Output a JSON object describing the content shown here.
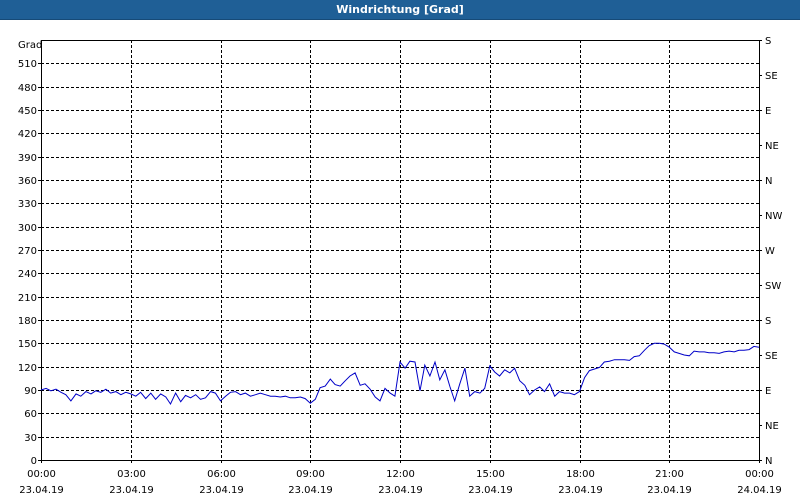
{
  "window": {
    "title": "Windrichtung [Grad]"
  },
  "chart_data": {
    "type": "line",
    "title": "Windrichtung [Grad]",
    "ylabel": "Grad",
    "ylim": [
      0,
      540
    ],
    "yticks": [
      0,
      30,
      60,
      90,
      120,
      150,
      180,
      210,
      240,
      270,
      300,
      330,
      360,
      390,
      420,
      450,
      480,
      510
    ],
    "right_axis_labels": [
      {
        "value": 0,
        "label": "N"
      },
      {
        "value": 45,
        "label": "NE"
      },
      {
        "value": 90,
        "label": "E"
      },
      {
        "value": 135,
        "label": "SE"
      },
      {
        "value": 180,
        "label": "S"
      },
      {
        "value": 225,
        "label": "SW"
      },
      {
        "value": 270,
        "label": "W"
      },
      {
        "value": 315,
        "label": "NW"
      },
      {
        "value": 360,
        "label": "N"
      },
      {
        "value": 405,
        "label": "NE"
      },
      {
        "value": 450,
        "label": "E"
      },
      {
        "value": 495,
        "label": "SE"
      },
      {
        "value": 540,
        "label": "S"
      }
    ],
    "xlim": [
      0,
      24
    ],
    "xticks": [
      {
        "hour": 0,
        "time": "00:00",
        "date": "23.04.19"
      },
      {
        "hour": 3,
        "time": "03:00",
        "date": "23.04.19"
      },
      {
        "hour": 6,
        "time": "06:00",
        "date": "23.04.19"
      },
      {
        "hour": 9,
        "time": "09:00",
        "date": "23.04.19"
      },
      {
        "hour": 12,
        "time": "12:00",
        "date": "23.04.19"
      },
      {
        "hour": 15,
        "time": "15:00",
        "date": "23.04.19"
      },
      {
        "hour": 18,
        "time": "18:00",
        "date": "23.04.19"
      },
      {
        "hour": 21,
        "time": "21:00",
        "date": "23.04.19"
      },
      {
        "hour": 24,
        "time": "00:00",
        "date": "24.04.19"
      }
    ],
    "grid": true,
    "series": [
      {
        "color": "#0000c8",
        "points": [
          [
            0.0,
            90
          ],
          [
            0.17,
            92
          ],
          [
            0.33,
            89
          ],
          [
            0.5,
            91
          ],
          [
            0.67,
            87
          ],
          [
            0.83,
            84
          ],
          [
            1.0,
            76
          ],
          [
            1.17,
            85
          ],
          [
            1.33,
            82
          ],
          [
            1.5,
            88
          ],
          [
            1.67,
            85
          ],
          [
            1.83,
            89
          ],
          [
            2.0,
            87
          ],
          [
            2.17,
            91
          ],
          [
            2.33,
            86
          ],
          [
            2.5,
            88
          ],
          [
            2.67,
            84
          ],
          [
            2.83,
            87
          ],
          [
            3.0,
            85
          ],
          [
            3.17,
            82
          ],
          [
            3.33,
            87
          ],
          [
            3.5,
            79
          ],
          [
            3.67,
            86
          ],
          [
            3.83,
            78
          ],
          [
            4.0,
            85
          ],
          [
            4.17,
            81
          ],
          [
            4.33,
            72
          ],
          [
            4.5,
            86
          ],
          [
            4.67,
            75
          ],
          [
            4.83,
            83
          ],
          [
            5.0,
            80
          ],
          [
            5.17,
            84
          ],
          [
            5.33,
            78
          ],
          [
            5.5,
            80
          ],
          [
            5.67,
            88
          ],
          [
            5.83,
            86
          ],
          [
            6.0,
            76
          ],
          [
            6.17,
            82
          ],
          [
            6.33,
            87
          ],
          [
            6.5,
            88
          ],
          [
            6.67,
            84
          ],
          [
            6.83,
            86
          ],
          [
            7.0,
            82
          ],
          [
            7.17,
            84
          ],
          [
            7.33,
            86
          ],
          [
            7.5,
            84
          ],
          [
            7.67,
            82
          ],
          [
            7.83,
            82
          ],
          [
            8.0,
            81
          ],
          [
            8.17,
            82
          ],
          [
            8.33,
            80
          ],
          [
            8.5,
            80
          ],
          [
            8.67,
            81
          ],
          [
            8.83,
            79
          ],
          [
            9.0,
            73
          ],
          [
            9.17,
            78
          ],
          [
            9.33,
            93
          ],
          [
            9.5,
            95
          ],
          [
            9.67,
            104
          ],
          [
            9.83,
            97
          ],
          [
            10.0,
            95
          ],
          [
            10.17,
            102
          ],
          [
            10.33,
            108
          ],
          [
            10.5,
            112
          ],
          [
            10.67,
            96
          ],
          [
            10.83,
            98
          ],
          [
            11.0,
            91
          ],
          [
            11.17,
            81
          ],
          [
            11.33,
            76
          ],
          [
            11.5,
            92
          ],
          [
            11.67,
            86
          ],
          [
            11.83,
            82
          ],
          [
            12.0,
            126
          ],
          [
            12.17,
            118
          ],
          [
            12.33,
            127
          ],
          [
            12.5,
            126
          ],
          [
            12.67,
            89
          ],
          [
            12.83,
            122
          ],
          [
            13.0,
            108
          ],
          [
            13.17,
            126
          ],
          [
            13.33,
            103
          ],
          [
            13.5,
            116
          ],
          [
            13.67,
            94
          ],
          [
            13.83,
            76
          ],
          [
            14.0,
            98
          ],
          [
            14.17,
            118
          ],
          [
            14.33,
            82
          ],
          [
            14.5,
            88
          ],
          [
            14.67,
            86
          ],
          [
            14.83,
            92
          ],
          [
            15.0,
            121
          ],
          [
            15.17,
            113
          ],
          [
            15.33,
            108
          ],
          [
            15.5,
            116
          ],
          [
            15.67,
            112
          ],
          [
            15.83,
            118
          ],
          [
            16.0,
            102
          ],
          [
            16.17,
            96
          ],
          [
            16.33,
            84
          ],
          [
            16.5,
            90
          ],
          [
            16.67,
            94
          ],
          [
            16.83,
            88
          ],
          [
            17.0,
            98
          ],
          [
            17.17,
            82
          ],
          [
            17.33,
            88
          ],
          [
            17.5,
            86
          ],
          [
            17.67,
            86
          ],
          [
            17.83,
            84
          ],
          [
            18.0,
            88
          ],
          [
            18.17,
            106
          ],
          [
            18.33,
            115
          ],
          [
            18.5,
            117
          ],
          [
            18.67,
            119
          ],
          [
            18.83,
            126
          ],
          [
            19.0,
            127
          ],
          [
            19.17,
            129
          ],
          [
            19.33,
            129
          ],
          [
            19.5,
            129
          ],
          [
            19.67,
            128
          ],
          [
            19.83,
            133
          ],
          [
            20.0,
            134
          ],
          [
            20.17,
            141
          ],
          [
            20.33,
            147
          ],
          [
            20.5,
            150
          ],
          [
            20.67,
            150
          ],
          [
            20.83,
            149
          ],
          [
            21.0,
            145
          ],
          [
            21.17,
            139
          ],
          [
            21.33,
            137
          ],
          [
            21.5,
            135
          ],
          [
            21.67,
            134
          ],
          [
            21.83,
            140
          ],
          [
            22.0,
            139
          ],
          [
            22.17,
            139
          ],
          [
            22.33,
            138
          ],
          [
            22.5,
            138
          ],
          [
            22.67,
            137
          ],
          [
            22.83,
            139
          ],
          [
            23.0,
            140
          ],
          [
            23.17,
            139
          ],
          [
            23.33,
            141
          ],
          [
            23.5,
            141
          ],
          [
            23.67,
            142
          ],
          [
            23.83,
            146
          ],
          [
            24.0,
            145
          ]
        ]
      }
    ]
  }
}
